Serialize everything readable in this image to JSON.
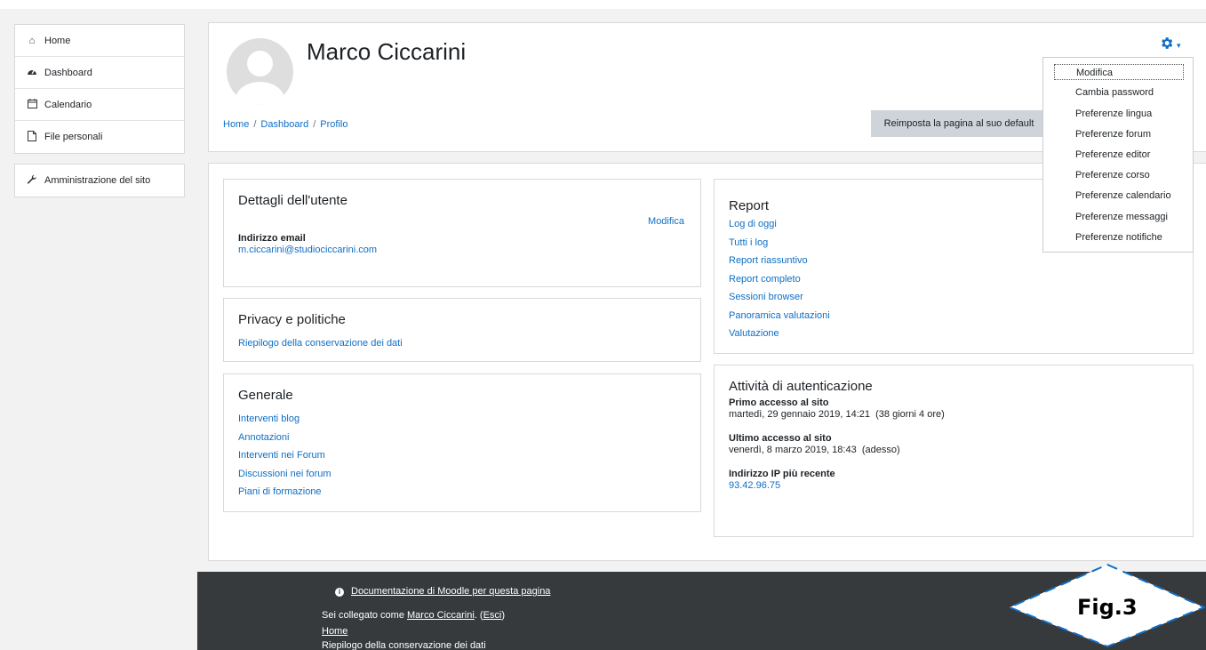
{
  "sidebar": {
    "items": [
      {
        "label": "Home",
        "icon": "home-icon"
      },
      {
        "label": "Dashboard",
        "icon": "dashboard-icon"
      },
      {
        "label": "Calendario",
        "icon": "calendar-icon"
      },
      {
        "label": "File personali",
        "icon": "file-icon"
      }
    ],
    "admin": {
      "label": "Amministrazione del sito",
      "icon": "wrench-icon"
    }
  },
  "header": {
    "user_name": "Marco Ciccarini",
    "breadcrumb": [
      "Home",
      "Dashboard",
      "Profilo"
    ],
    "reset_button": "Reimposta la pagina al suo default"
  },
  "settings_menu": {
    "items": [
      "Modifica",
      "Cambia password",
      "Preferenze lingua",
      "Preferenze forum",
      "Preferenze editor",
      "Preferenze corso",
      "Preferenze calendario",
      "Preferenze messaggi",
      "Preferenze notifiche"
    ]
  },
  "user_details": {
    "title": "Dettagli dell'utente",
    "edit_link": "Modifica",
    "email_label": "Indirizzo email",
    "email_value": "m.ciccarini@studiociccarini.com"
  },
  "privacy": {
    "title": "Privacy e politiche",
    "links": [
      "Riepilogo della conservazione dei dati"
    ]
  },
  "general": {
    "title": "Generale",
    "links": [
      "Interventi blog",
      "Annotazioni",
      "Interventi nei Forum",
      "Discussioni nei forum",
      "Piani di formazione"
    ]
  },
  "report": {
    "title": "Report",
    "links": [
      "Log di oggi",
      "Tutti i log",
      "Report riassuntivo",
      "Report completo",
      "Sessioni browser",
      "Panoramica valutazioni",
      "Valutazione"
    ]
  },
  "auth_activity": {
    "title": "Attività di autenticazione",
    "first_access_label": "Primo accesso al sito",
    "first_access_value": "martedì, 29 gennaio 2019, 14:21  (38 giorni 4 ore)",
    "last_access_label": "Ultimo accesso al sito",
    "last_access_value": "venerdì, 8 marzo 2019, 18:43  (adesso)",
    "ip_label": "Indirizzo IP più recente",
    "ip_value": "93.42.96.75"
  },
  "footer": {
    "doc_link": "Documentazione di Moodle per questa pagina",
    "logged_prefix": "Sei collegato come ",
    "logged_user": "Marco Ciccarini",
    "logged_sep": ". (",
    "logout": "Esci",
    "logged_suffix": ")",
    "home": "Home",
    "data_retention": "Riepilogo della conservazione dei dati"
  },
  "figure_label": "Fig.3",
  "colors": {
    "link": "#0f6fc5",
    "footer_bg": "#373a3c",
    "figure_outline": "#0f6fc5"
  }
}
